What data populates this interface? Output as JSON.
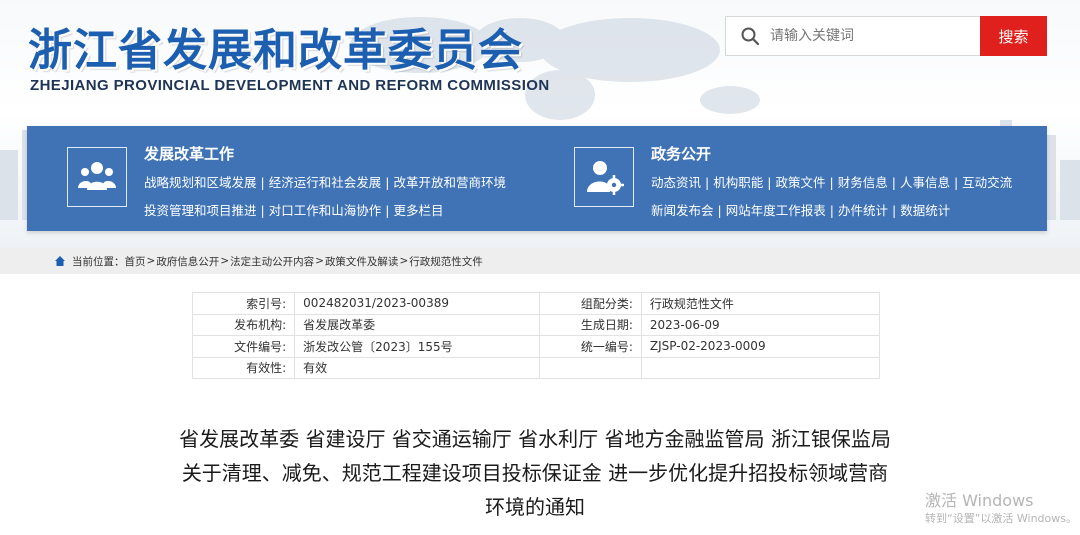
{
  "header": {
    "title": "浙江省发展和改革委员会",
    "subtitle": "ZHEJIANG PROVINCIAL DEVELOPMENT AND REFORM COMMISSION"
  },
  "search": {
    "placeholder": "请输入关键词",
    "button_label": "搜索"
  },
  "nav": {
    "groups": [
      {
        "title": "发展改革工作",
        "icon": "people-group-icon",
        "line1": [
          "战略规划和区域发展",
          "经济运行和社会发展",
          "改革开放和营商环境"
        ],
        "line2": [
          "投资管理和项目推进",
          "对口工作和山海协作",
          "更多栏目"
        ]
      },
      {
        "title": "政务公开",
        "icon": "user-gear-icon",
        "line1": [
          "动态资讯",
          "机构职能",
          "政策文件",
          "财务信息",
          "人事信息",
          "互动交流"
        ],
        "line2": [
          "新闻发布会",
          "网站年度工作报表",
          "办件统计",
          "数据统计"
        ]
      }
    ],
    "separator": "|"
  },
  "breadcrumb": {
    "label": "当前位置：",
    "items": [
      "首页",
      "政府信息公开",
      "法定主动公开内容",
      "政策文件及解读",
      "行政规范性文件"
    ],
    "separator": ">"
  },
  "meta": {
    "rows": [
      [
        {
          "k": "索引号:",
          "v": "002482031/2023-00389"
        },
        {
          "k": "组配分类:",
          "v": "行政规范性文件"
        }
      ],
      [
        {
          "k": "发布机构:",
          "v": "省发展改革委"
        },
        {
          "k": "生成日期:",
          "v": "2023-06-09"
        }
      ],
      [
        {
          "k": "文件编号:",
          "v": "浙发改公管〔2023〕155号"
        },
        {
          "k": "统一编号:",
          "v": "ZJSP-02-2023-0009"
        }
      ],
      [
        {
          "k": "有效性:",
          "v": "有效"
        },
        {
          "k": "",
          "v": ""
        }
      ]
    ]
  },
  "document": {
    "title_lines": [
      "省发展改革委 省建设厅 省交通运输厅 省水利厅 省地方金融监管局 浙江银保监局",
      "关于清理、减免、规范工程建设项目投标保证金 进一步优化提升招投标领域营商",
      "环境的通知"
    ]
  },
  "watermark": {
    "line1": "激活 Windows",
    "line2": "转到“设置”以激活 Windows。"
  },
  "colors": {
    "title_blue": "#1c5fb0",
    "nav_blue": "#3f73b5",
    "search_red": "#e0201d"
  }
}
